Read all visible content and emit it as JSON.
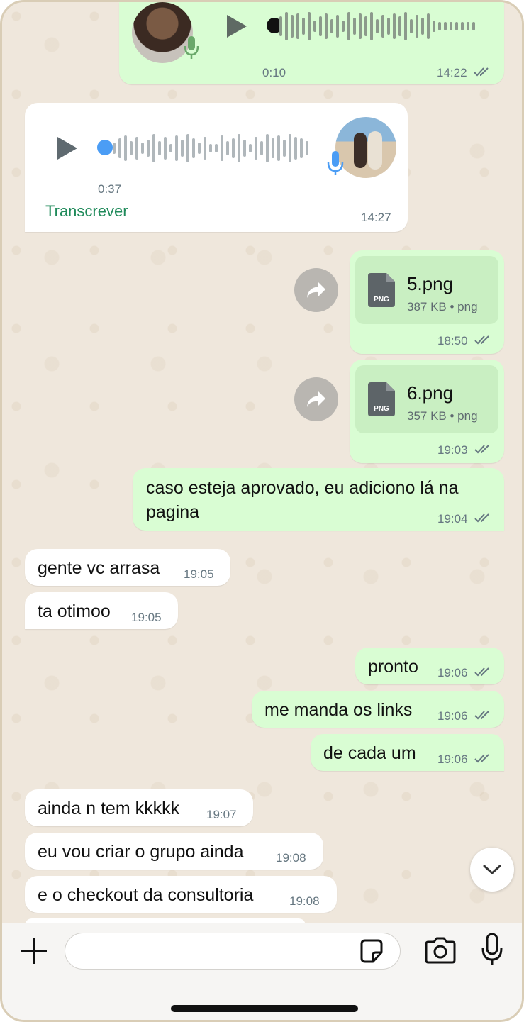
{
  "audio_out": {
    "duration": "0:10",
    "time": "14:22"
  },
  "audio_in": {
    "duration": "0:37",
    "transcribe_label": "Transcrever",
    "time": "14:27"
  },
  "file1": {
    "name": "5.png",
    "meta": "387 KB • png",
    "icon_label": "PNG",
    "time": "18:50"
  },
  "file2": {
    "name": "6.png",
    "meta": "357 KB • png",
    "icon_label": "PNG",
    "time": "19:03"
  },
  "messages": [
    {
      "dir": "out",
      "text_line1": "caso esteja aprovado, eu adiciono lá na",
      "text_line2": "pagina",
      "time": "19:04"
    },
    {
      "dir": "in",
      "text": "gente vc arrasa",
      "time": "19:05"
    },
    {
      "dir": "in",
      "text": "ta otimoo",
      "time": "19:05"
    },
    {
      "dir": "out",
      "text": "pronto",
      "time": "19:06"
    },
    {
      "dir": "out",
      "text": "me manda os links",
      "time": "19:06"
    },
    {
      "dir": "out",
      "text": "de cada um",
      "time": "19:06"
    },
    {
      "dir": "in",
      "text": "ainda n tem kkkkk",
      "time": "19:07"
    },
    {
      "dir": "in",
      "text": "eu vou criar o grupo ainda",
      "time": "19:08"
    },
    {
      "dir": "in",
      "text": "e o checkout da consultoria",
      "time": "19:08"
    }
  ],
  "composer": {
    "placeholder": ""
  },
  "colors": {
    "outgoing": "#d9fdd3",
    "incoming": "#ffffff",
    "accent_green": "#1f8a5a",
    "audio_blue": "#4b9df5"
  },
  "icons": [
    "play-icon",
    "mic-icon",
    "forward-icon",
    "png-file-icon",
    "chevron-down-icon",
    "plus-icon",
    "sticker-icon",
    "camera-icon",
    "read-ticks-icon"
  ]
}
